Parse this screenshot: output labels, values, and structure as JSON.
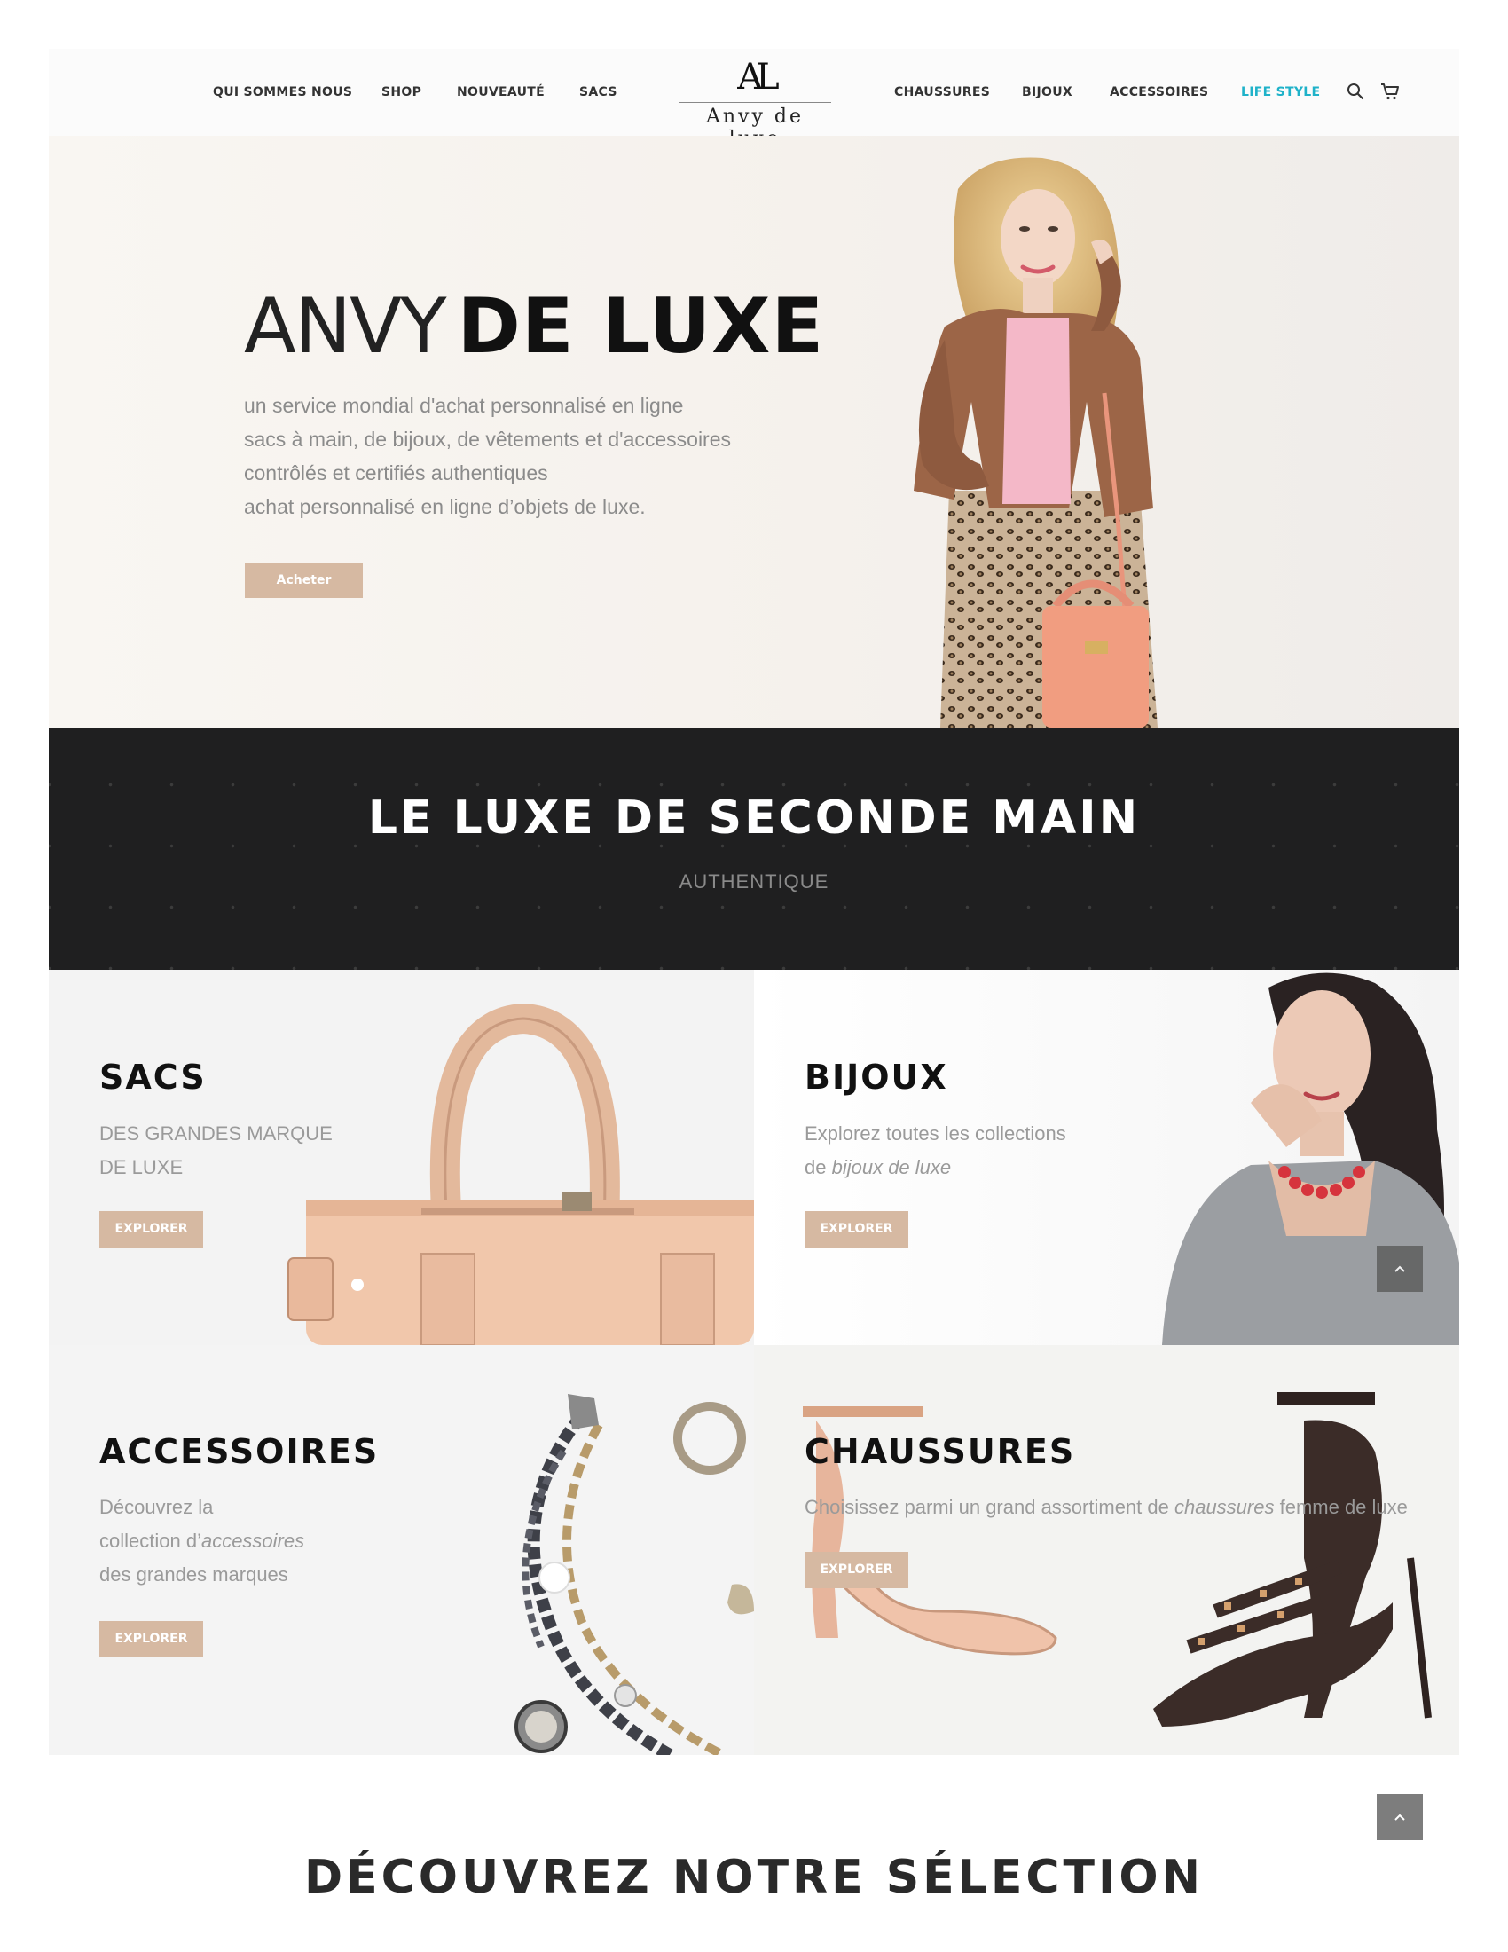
{
  "nav": {
    "left_items": [
      "QUI SOMMES NOUS",
      "SHOP",
      "NOUVEAUTÉ",
      "SACS"
    ],
    "right_items": [
      "CHAUSSURES",
      "BIJOUX",
      "ACCESSOIRES",
      "LIFE STYLE"
    ],
    "accent_color": "#1fb2c9",
    "logo": {
      "mark": "AL",
      "name": "Anvy de luxe"
    },
    "icons": [
      "search-icon",
      "cart-icon"
    ]
  },
  "hero": {
    "title_light": "ANVY",
    "title_bold": "DE LUXE",
    "lines": [
      "un service mondial d'achat personnalisé en ligne",
      "sacs à main, de bijoux, de vêtements et d'accessoires",
      "contrôlés et certifiés authentiques",
      "achat personnalisé en ligne d’objets de luxe."
    ],
    "button": "Acheter",
    "button_color": "#d6b9a2"
  },
  "banner": {
    "title": "LE LUXE DE SECONDE MAIN",
    "subtitle": "AUTHENTIQUE"
  },
  "categories": {
    "sacs": {
      "title": "SACS",
      "line1": "DES GRANDES MARQUE",
      "line2": "DE LUXE",
      "button": "EXPLORER"
    },
    "bijoux": {
      "title": "BIJOUX",
      "line1": "Explorez toutes les collections",
      "line2_prefix": "de ",
      "line2_em": "bijoux de luxe",
      "button": "EXPLORER"
    },
    "accessoires": {
      "title": "ACCESSOIRES",
      "line1": "Découvrez la",
      "line2_prefix": "collection d’",
      "line2_em": "accessoires",
      "line3": "des grandes marques",
      "button": "EXPLORER"
    },
    "chaussures": {
      "title": "CHAUSSURES",
      "line1_prefix": "Choisissez parmi un grand assortiment de ",
      "line1_em": "chaussures",
      "line1_suffix": " femme de luxe",
      "button": "EXPLORER"
    }
  },
  "selection": {
    "title": "DÉCOUVREZ NOTRE SÉLECTION"
  },
  "icons": {
    "scroll_top": "chevron-up-icon"
  }
}
